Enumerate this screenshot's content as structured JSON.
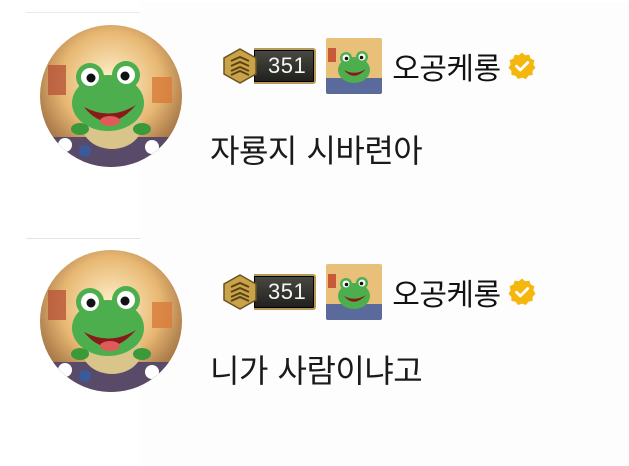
{
  "comments": [
    {
      "level": "351",
      "nickname": "오공케롱",
      "text": "자룡지 시바련아",
      "avatar_icon": "frog-avatar-icon",
      "badge_icon": "frog-badge-icon",
      "verified": true
    },
    {
      "level": "351",
      "nickname": "오공케롱",
      "text": "니가 사람이냐고",
      "avatar_icon": "frog-avatar-icon",
      "badge_icon": "frog-badge-icon",
      "verified": true
    }
  ],
  "colors": {
    "verified": "#f5b60e",
    "level_plate": "#2a2a26",
    "level_border": "#b69a55",
    "frog_green": "#4cae4c"
  }
}
